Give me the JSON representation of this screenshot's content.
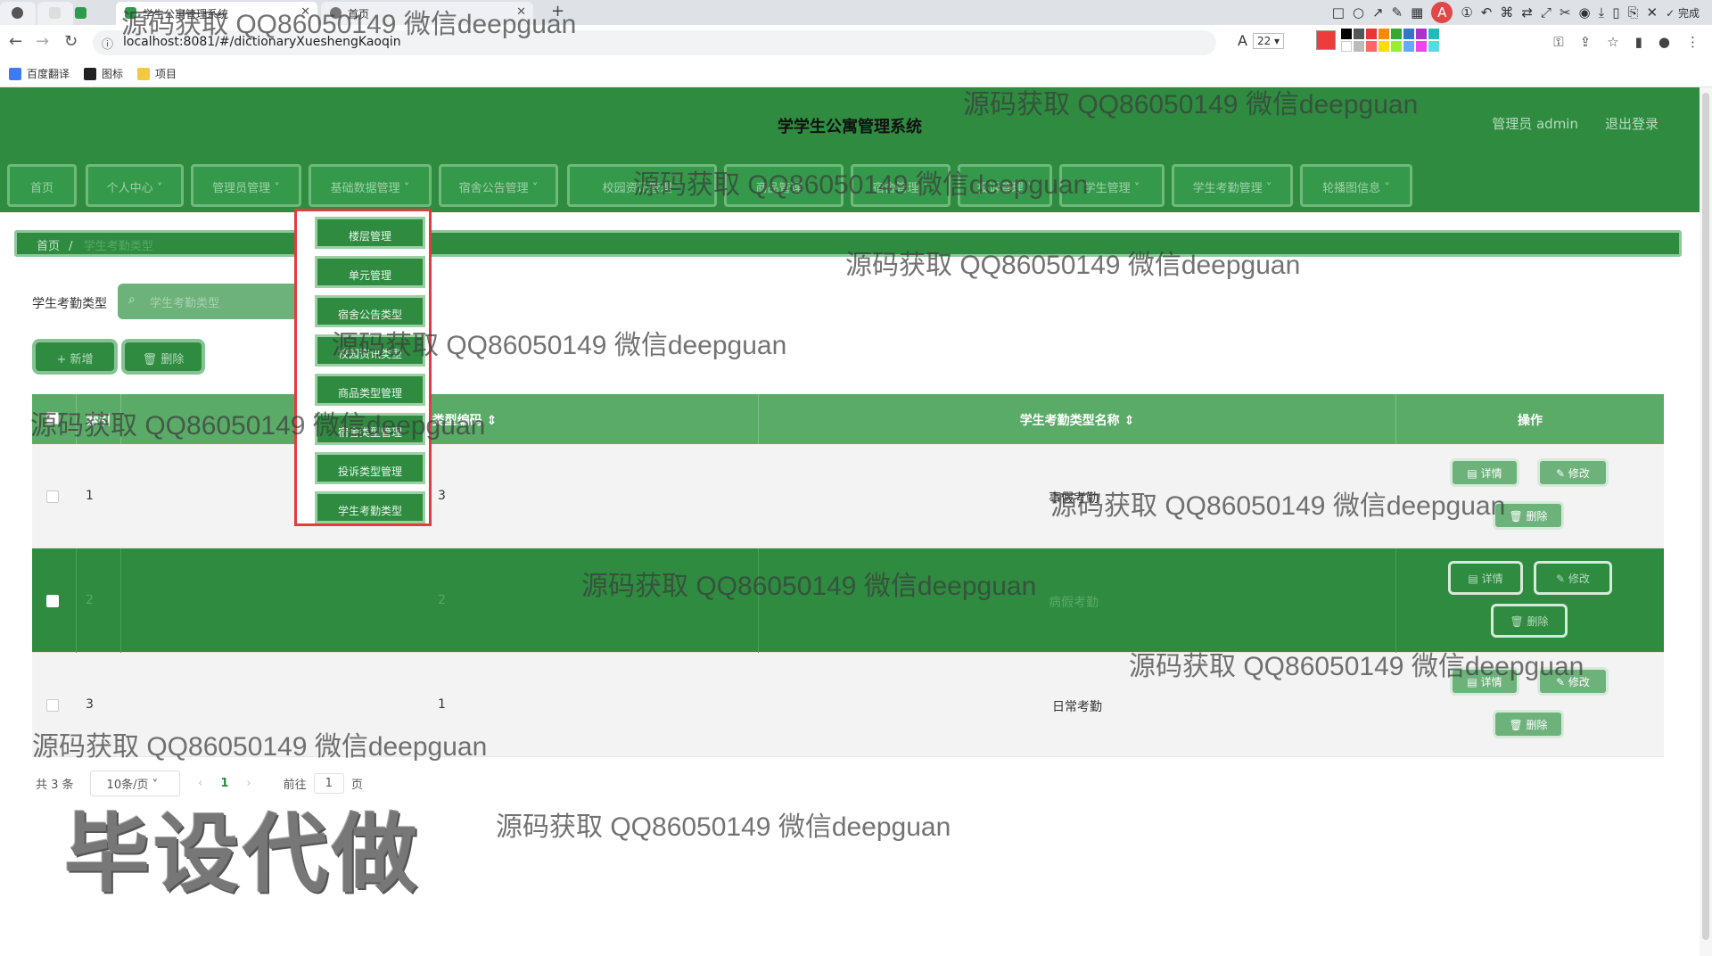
{
  "browser": {
    "tabs": [
      {
        "title": "学生公寓管理系统",
        "active": true
      },
      {
        "title": "首页",
        "active": false
      }
    ],
    "url": "localhost:8081/#/dictionaryXueshengKaoqin",
    "annotation_font_size": "22",
    "annotation_done": "完成",
    "bookmarks": [
      "百度翻译",
      "图标",
      "项目"
    ],
    "colors": {
      "accent": "#2e8b40",
      "highlight_box": "#e53b3b"
    }
  },
  "app": {
    "title": "学学生公寓管理系统",
    "user": "管理员 admin",
    "logout": "退出登录"
  },
  "menu": [
    "首页",
    "个人中心",
    "管理员管理",
    "基础数据管理",
    "宿舍公告管理",
    "校园资讯管理",
    "商品管理",
    "宿舍管理",
    "投诉管理",
    "学生管理",
    "学生考勤管理",
    "轮播图信息"
  ],
  "breadcrumb": {
    "home": "首页",
    "sep": "/",
    "current": "学生考勤类型"
  },
  "search": {
    "label": "学生考勤类型",
    "placeholder": "学生考勤类型"
  },
  "toolbar": {
    "add": "+ 新增",
    "delete": "删除"
  },
  "table": {
    "headers": {
      "index": "索引",
      "code": "学生考勤类型编码",
      "name": "学生考勤类型名称",
      "ops": "操作"
    },
    "rows": [
      {
        "index": "1",
        "code": "3",
        "name": "事假考勤"
      },
      {
        "index": "2",
        "code": "2",
        "name": "病假考勤"
      },
      {
        "index": "3",
        "code": "1",
        "name": "日常考勤"
      }
    ],
    "ops": {
      "detail": "详情",
      "edit": "修改",
      "delete": "删除"
    }
  },
  "pagination": {
    "total": "共 3 条",
    "page_size": "10条/页",
    "current": "1",
    "goto": "前往",
    "goto_value": "1",
    "page_unit": "页"
  },
  "dropdown": {
    "items": [
      "楼层管理",
      "单元管理",
      "宿舍公告类型",
      "校园资讯类型",
      "商品类型管理",
      "宿舍类型管理",
      "投诉类型管理",
      "学生考勤类型"
    ]
  },
  "watermarks": {
    "text": "源码获取 QQ86050149 微信deepguan",
    "big": "毕设代做"
  }
}
